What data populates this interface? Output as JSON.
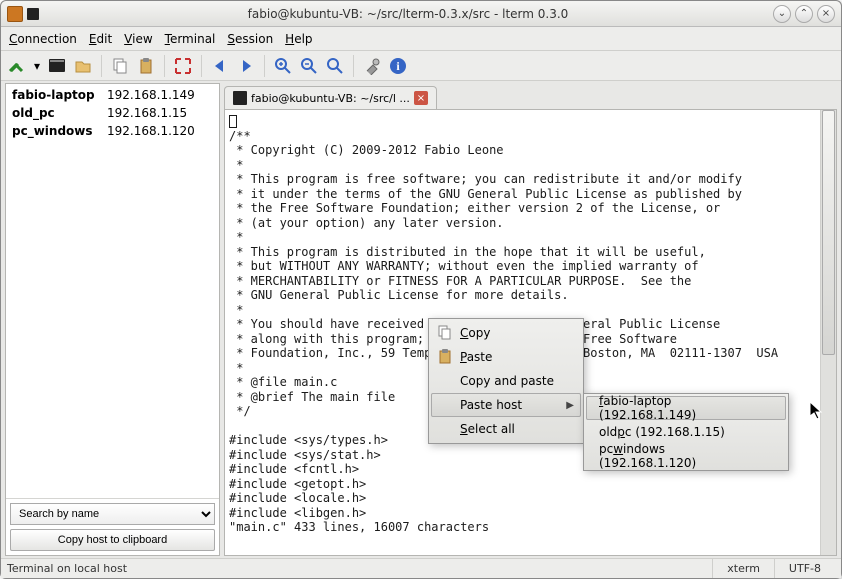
{
  "window": {
    "title": "fabio@kubuntu-VB: ~/src/lterm-0.3.x/src - lterm 0.3.0"
  },
  "menu": {
    "connection": "Connection",
    "edit": "Edit",
    "view": "View",
    "terminal": "Terminal",
    "session": "Session",
    "help": "Help"
  },
  "sidebar": {
    "hosts": [
      {
        "name": "fabio-laptop",
        "ip": "192.168.1.149"
      },
      {
        "name": "old_pc",
        "ip": "192.168.1.15"
      },
      {
        "name": "pc_windows",
        "ip": "192.168.1.120"
      }
    ],
    "search_label": "Search by name",
    "copy_button": "Copy host to clipboard"
  },
  "tab": {
    "label": "fabio@kubuntu-VB: ~/src/l ..."
  },
  "terminal": {
    "content": "\n/**\n * Copyright (C) 2009-2012 Fabio Leone\n *\n * This program is free software; you can redistribute it and/or modify\n * it under the terms of the GNU General Public License as published by\n * the Free Software Foundation; either version 2 of the License, or\n * (at your option) any later version.\n *\n * This program is distributed in the hope that it will be useful,\n * but WITHOUT ANY WARRANTY; without even the implied warranty of\n * MERCHANTABILITY or FITNESS FOR A PARTICULAR PURPOSE.  See the\n * GNU General Public License for more details.\n *\n * You should have received a copy of the GNU General Public License\n * along with this program; if not, write to the Free Software\n * Foundation, Inc., 59 Temple Place, Suite 330, Boston, MA  02111-1307  USA\n *\n * @file main.c\n * @brief The main file\n */\n\n#include <sys/types.h>\n#include <sys/stat.h>\n#include <fcntl.h>\n#include <getopt.h>\n#include <locale.h>\n#include <libgen.h>\n\"main.c\" 433 lines, 16007 characters"
  },
  "context_menu": {
    "copy": "Copy",
    "paste": "Paste",
    "copy_and_paste": "Copy and paste",
    "paste_host": "Paste host",
    "select_all": "Select all",
    "hosts": [
      "fabio-laptop (192.168.1.149)",
      "oldpc (192.168.1.15)",
      "pcwindows (192.168.1.120)"
    ]
  },
  "status": {
    "left": "Terminal on local host",
    "term": "xterm",
    "enc": "UTF-8"
  },
  "icons": {
    "connect": "connect-icon",
    "terminal": "terminal-icon",
    "duplicate": "duplicate-icon",
    "copy": "copy-icon",
    "paste": "paste-icon",
    "find": "find-icon",
    "fullscreen": "fullscreen-icon",
    "back": "back-icon",
    "forward": "forward-icon",
    "zoom_in": "zoom-in-icon",
    "zoom_out": "zoom-out-icon",
    "zoom_reset": "zoom-reset-icon",
    "prefs": "preferences-icon",
    "info": "info-icon"
  }
}
